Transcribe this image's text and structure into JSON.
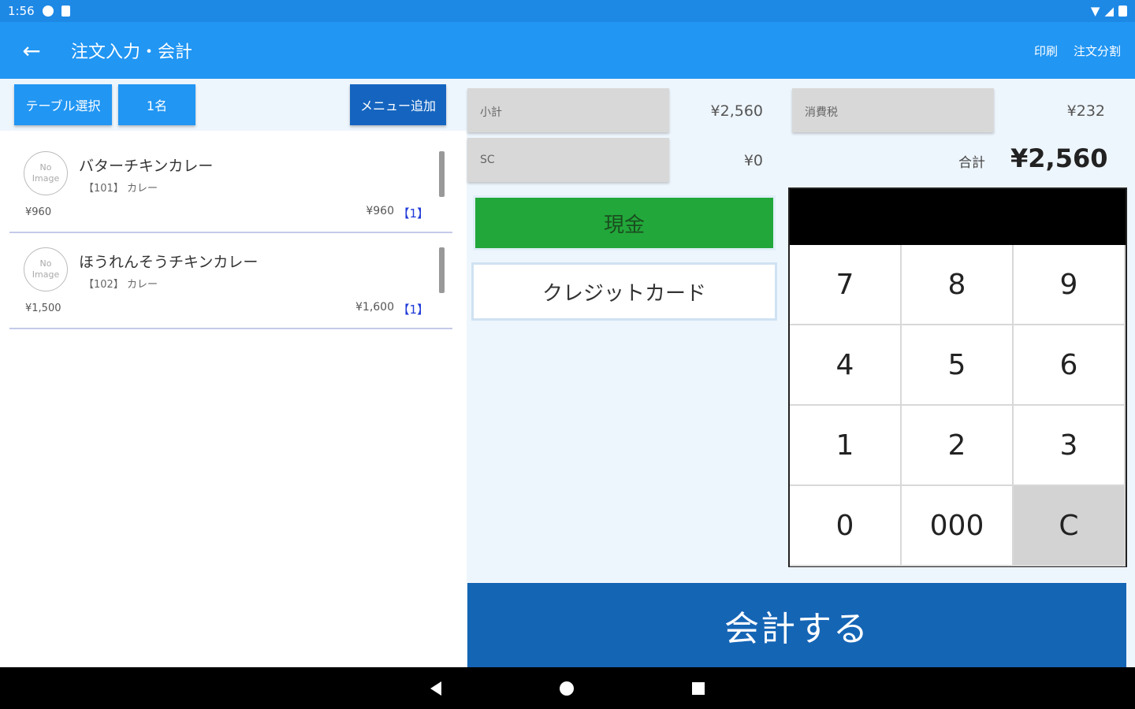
{
  "status_bar": {
    "time": "1:56"
  },
  "app_bar": {
    "title": "注文入力・会計",
    "actions": {
      "print": "印刷",
      "split": "注文分割"
    }
  },
  "left_panel": {
    "table_select": "テーブル選択",
    "guests": "1名",
    "add_menu": "メニュー追加",
    "items": [
      {
        "no_image_1": "No",
        "no_image_2": "Image",
        "name": "バターチキンカレー",
        "code_category": "【101】 カレー",
        "unit_price": "¥960",
        "total": "¥960",
        "qty": "【1】"
      },
      {
        "no_image_1": "No",
        "no_image_2": "Image",
        "name": "ほうれんそうチキンカレー",
        "code_category": "【102】 カレー",
        "unit_price": "¥1,500",
        "total": "¥1,600",
        "qty": "【1】"
      }
    ]
  },
  "summary": {
    "subtotal_label": "小計",
    "subtotal_value": "¥2,560",
    "tax_label": "消費税",
    "tax_value": "¥232",
    "sc_label": "SC",
    "sc_value": "¥0",
    "total_label": "合計",
    "total_value": "¥2,560"
  },
  "payment": {
    "cash": "現金",
    "credit": "クレジットカード"
  },
  "keypad": {
    "display": "",
    "keys": [
      "7",
      "8",
      "9",
      "4",
      "5",
      "6",
      "1",
      "2",
      "3",
      "0",
      "000",
      "C"
    ]
  },
  "checkout": "会計する",
  "colors": {
    "appbar": "#2196f3",
    "cash": "#22a83a",
    "checkout": "#1565b5"
  }
}
